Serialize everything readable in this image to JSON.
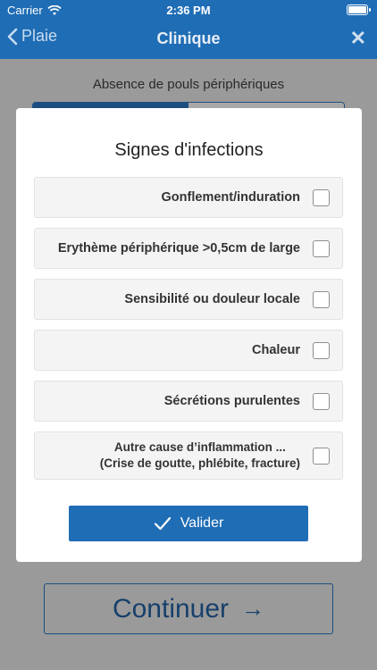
{
  "status_bar": {
    "carrier": "Carrier",
    "time": "2:36 PM"
  },
  "navbar": {
    "back_label": "Plaie",
    "title": "Clinique",
    "close_symbol": "✕"
  },
  "background": {
    "field_label": "Absence de pouls périphériques",
    "continue_label": "Continuer",
    "continue_arrow": "→"
  },
  "modal": {
    "title": "Signes d'infections",
    "options": [
      {
        "label": "Gonflement/induration",
        "checked": false
      },
      {
        "label": "Erythème périphérique >0,5cm de large",
        "checked": false
      },
      {
        "label": "Sensibilité ou douleur locale",
        "checked": false
      },
      {
        "label": "Chaleur",
        "checked": false
      },
      {
        "label": "Sécrétions purulentes",
        "checked": false
      },
      {
        "label_line1": "Autre cause d’inflammation ...",
        "label_line2": "(Crise de goutte, phlébite, fracture)",
        "checked": false
      }
    ],
    "validate_label": "Valider"
  },
  "colors": {
    "primary": "#1f6db5",
    "dark_primary": "#1a4d80",
    "overlay": "#9a9a9a"
  }
}
